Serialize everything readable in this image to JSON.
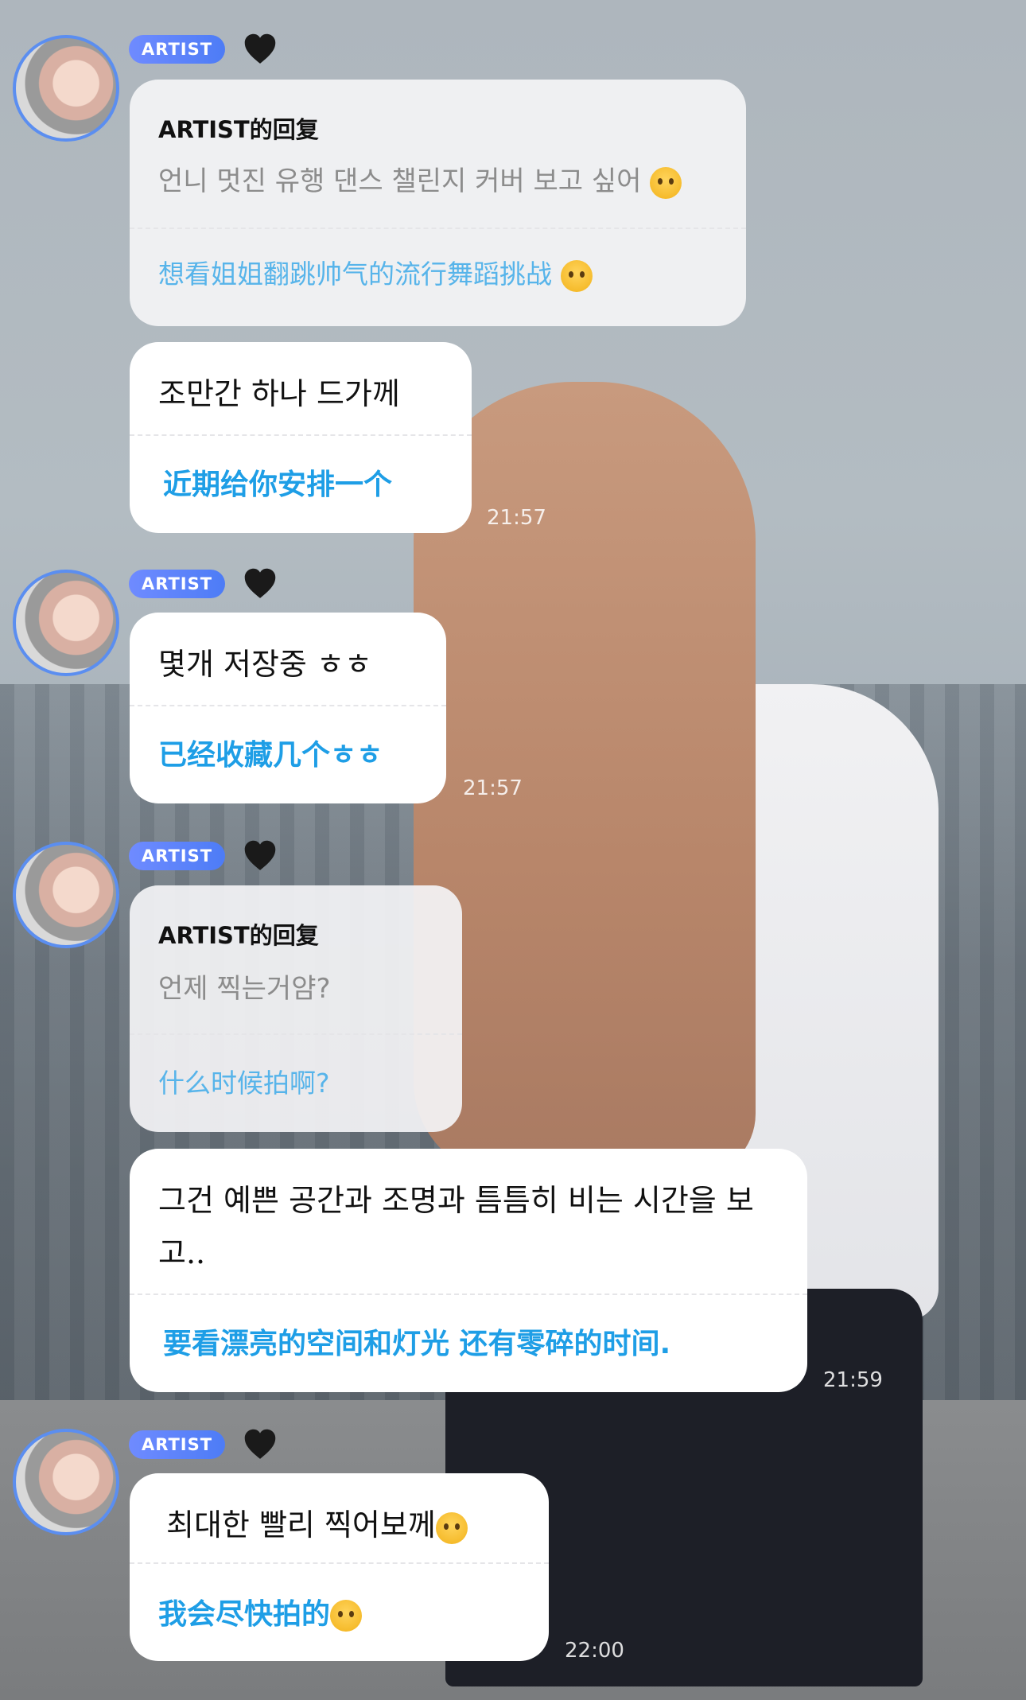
{
  "badge_label": "ARTIST",
  "heart_icon": "black-heart-icon",
  "accent_color": "#1e9ee6",
  "messages": [
    {
      "reply_title": "ARTIST的回复",
      "quote": "언니 멋진 유행 댄스 챌린지 커버 보고 싶어",
      "translation": "想看姐姐翻跳帅气的流行舞蹈挑战"
    },
    {
      "original": "조만간 하나 드가께",
      "translation": "近期给你安排一个",
      "time": "21:57"
    },
    {
      "original": "몇개 저장중 ㅎㅎ",
      "translation": "已经收藏几个ㅎㅎ",
      "time": "21:57"
    },
    {
      "reply_title": "ARTIST的回复",
      "quote": "언제 찍는거얌?",
      "translation": "什么时候拍啊?"
    },
    {
      "original_line1": "그건 예쁜 공간과 조명과 틈틈히 비는 시간을 보",
      "original_line2": "고..",
      "translation": "要看漂亮的空间和灯光 还有零碎的时间.",
      "time": "21:59"
    },
    {
      "original": "최대한 빨리 찍어보께",
      "translation": "我会尽快拍的",
      "time": "22:00"
    }
  ]
}
